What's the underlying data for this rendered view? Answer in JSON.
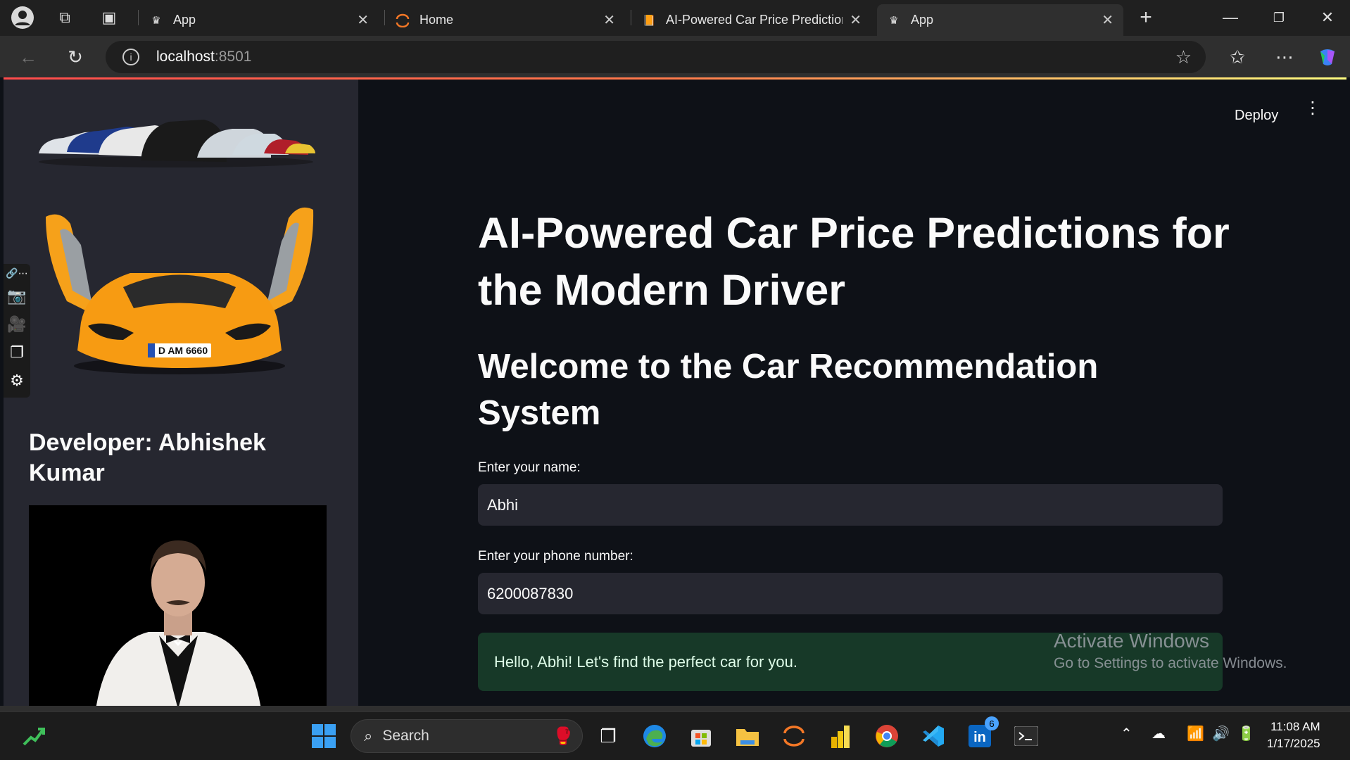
{
  "browser": {
    "tabs": [
      {
        "title": "App",
        "favicon": "crown-icon"
      },
      {
        "title": "Home",
        "favicon": "jupyter-icon"
      },
      {
        "title": "AI-Powered Car Price Predictions",
        "favicon": "book-icon"
      },
      {
        "title": "App",
        "favicon": "crown-icon"
      }
    ],
    "url_host": "localhost",
    "url_port": ":8501",
    "new_tab": "+"
  },
  "sidebar": {
    "developer": "Developer: Abhishek Kumar",
    "plate": "D AM 6660"
  },
  "header": {
    "deploy_label": "Deploy"
  },
  "main": {
    "title": "AI-Powered Car Price Predictions for the Modern Driver",
    "subtitle": "Welcome to the Car Recommendation System",
    "name_label": "Enter your name:",
    "name_value": "Abhi",
    "phone_label": "Enter your phone number:",
    "phone_value": "6200087830",
    "success_message": "Hello, Abhi! Let's find the perfect car for you."
  },
  "watermark": {
    "line1": "Activate Windows",
    "line2": "Go to Settings to activate Windows."
  },
  "taskbar": {
    "search_label": "Search",
    "time": "11:08 AM",
    "date": "1/17/2025",
    "linkedin_badge": "6"
  },
  "colors": {
    "accent": "#ff4b4b",
    "success_bg": "#173928",
    "sidebar_bg": "#262730",
    "main_bg": "#0e1117"
  }
}
